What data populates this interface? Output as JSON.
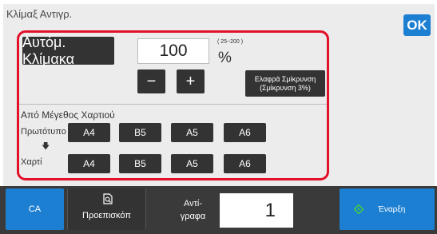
{
  "header": {
    "title": "Κλίμαξ Αντιγρ.",
    "ok_label": "OK"
  },
  "zoom": {
    "auto_label": "Αυτόμ. Κλίμακα",
    "value": "100",
    "range": "( 25~200 )",
    "unit": "%",
    "decrement_label": "−",
    "increment_label": "+",
    "slight_reduce_line1": "Ελαφρά Σμίκρυνση",
    "slight_reduce_line2": "(Σμίκρυνση 3%)"
  },
  "paper": {
    "section_label": "Από Μέγεθος Χαρτιού",
    "original_label": "Πρωτότυπο",
    "arrow": "🡇",
    "paper_label": "Χαρτί",
    "original_sizes": [
      "A4",
      "B5",
      "A5",
      "A6"
    ],
    "paper_sizes": [
      "A4",
      "B5",
      "A5",
      "A6"
    ]
  },
  "footer": {
    "ca_label": "CA",
    "preview_label": "Προεπισκόπ",
    "copies_label_line1": "Αντί-",
    "copies_label_line2": "γραφα",
    "copies_value": "1",
    "start_label": "Έναρξη"
  },
  "colors": {
    "accent": "#1d7fd1",
    "frame": "#e3102a",
    "button": "#333333",
    "start_icon": "#3cc94a"
  }
}
